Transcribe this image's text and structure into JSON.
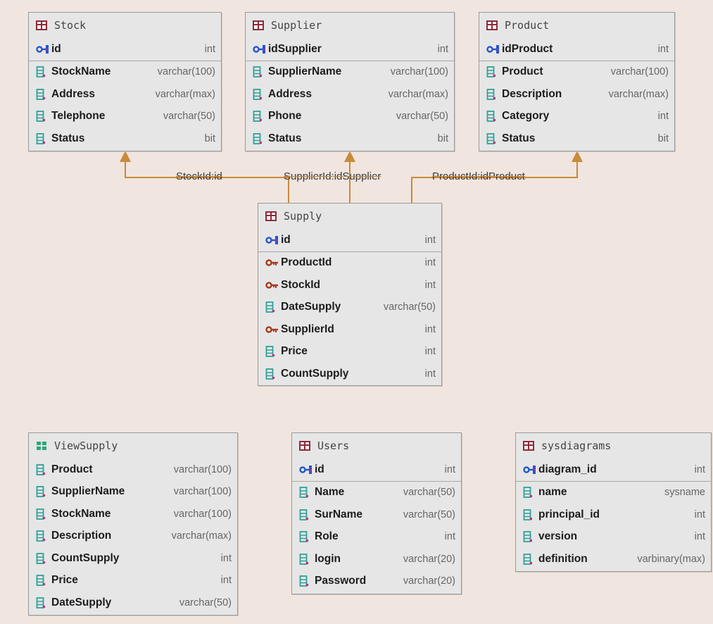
{
  "colors": {
    "background": "#f1e5df",
    "connector": "#c98a3a",
    "table_fill": "#e6e6e6",
    "table_icon": "#8e2a38",
    "view_icon": "#2aa87a",
    "pk_icon": "#2855c8",
    "fk_icon": "#a8391e",
    "column_icon": "#2fa198"
  },
  "tables": {
    "stock": {
      "title": "Stock",
      "pk": {
        "name": "id",
        "type": "int"
      },
      "columns": [
        {
          "name": "StockName",
          "type": "varchar(100)"
        },
        {
          "name": "Address",
          "type": "varchar(max)"
        },
        {
          "name": "Telephone",
          "type": "varchar(50)"
        },
        {
          "name": "Status",
          "type": "bit"
        }
      ]
    },
    "supplier": {
      "title": "Supplier",
      "pk": {
        "name": "idSupplier",
        "type": "int"
      },
      "columns": [
        {
          "name": "SupplierName",
          "type": "varchar(100)"
        },
        {
          "name": "Address",
          "type": "varchar(max)"
        },
        {
          "name": "Phone",
          "type": "varchar(50)"
        },
        {
          "name": "Status",
          "type": "bit"
        }
      ]
    },
    "product": {
      "title": "Product",
      "pk": {
        "name": "idProduct",
        "type": "int"
      },
      "columns": [
        {
          "name": "Product",
          "type": "varchar(100)"
        },
        {
          "name": "Description",
          "type": "varchar(max)"
        },
        {
          "name": "Category",
          "type": "int"
        },
        {
          "name": "Status",
          "type": "bit"
        }
      ]
    },
    "supply": {
      "title": "Supply",
      "pk": {
        "name": "id",
        "type": "int"
      },
      "columns": [
        {
          "name": "ProductId",
          "type": "int"
        },
        {
          "name": "StockId",
          "type": "int"
        },
        {
          "name": "DateSupply",
          "type": "varchar(50)"
        },
        {
          "name": "SupplierId",
          "type": "int"
        },
        {
          "name": "Price",
          "type": "int"
        },
        {
          "name": "CountSupply",
          "type": "int"
        }
      ]
    },
    "viewsupply": {
      "title": "ViewSupply",
      "columns": [
        {
          "name": "Product",
          "type": "varchar(100)"
        },
        {
          "name": "SupplierName",
          "type": "varchar(100)"
        },
        {
          "name": "StockName",
          "type": "varchar(100)"
        },
        {
          "name": "Description",
          "type": "varchar(max)"
        },
        {
          "name": "CountSupply",
          "type": "int"
        },
        {
          "name": "Price",
          "type": "int"
        },
        {
          "name": "DateSupply",
          "type": "varchar(50)"
        }
      ]
    },
    "users": {
      "title": "Users",
      "pk": {
        "name": "id",
        "type": "int"
      },
      "columns": [
        {
          "name": "Name",
          "type": "varchar(50)"
        },
        {
          "name": "SurName",
          "type": "varchar(50)"
        },
        {
          "name": "Role",
          "type": "int"
        },
        {
          "name": "login",
          "type": "varchar(20)"
        },
        {
          "name": "Password",
          "type": "varchar(20)"
        }
      ]
    },
    "sysdiagrams": {
      "title": "sysdiagrams",
      "pk": {
        "name": "diagram_id",
        "type": "int"
      },
      "columns": [
        {
          "name": "name",
          "type": "sysname"
        },
        {
          "name": "principal_id",
          "type": "int"
        },
        {
          "name": "version",
          "type": "int"
        },
        {
          "name": "definition",
          "type": "varbinary(max)"
        }
      ]
    }
  },
  "relationships": {
    "stock_link": "StockId:id",
    "supplier_link": "SupplierId:idSupplier",
    "product_link": "ProductId:idProduct"
  }
}
